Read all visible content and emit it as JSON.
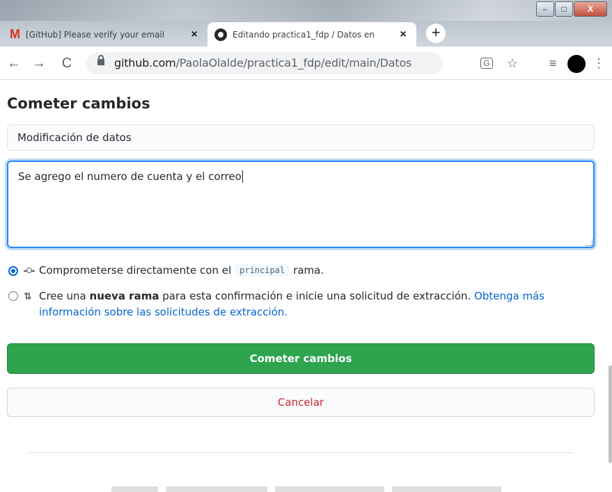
{
  "browser": {
    "tabs": [
      {
        "title": "[GitHub] Please verify your email",
        "icon": "gmail-icon",
        "active": false
      },
      {
        "title": "Editando practica1_fdp / Datos en",
        "icon": "github-icon",
        "active": true
      }
    ],
    "url_domain": "github.com",
    "url_path": "/PaolaOlalde/practica1_fdp/edit/main/Datos"
  },
  "commit": {
    "heading": "Cometer cambios",
    "summary_value": "Modificación de datos",
    "description_value": "Se agrego el numero de cuenta y el correo",
    "option_direct": {
      "prefix": "Comprometerse directamente con el",
      "branch": "principal",
      "suffix": "rama."
    },
    "option_new_branch": {
      "prefix": "Cree una",
      "bold": "nueva rama",
      "suffix": "para esta confirmación e inicie una solicitud de extracción.",
      "link": "Obtenga más información sobre las solicitudes de extracción."
    },
    "commit_button": "Cometer cambios",
    "cancel_button": "Cancelar"
  },
  "colors": {
    "accent": "#0366d6",
    "commit_green": "#2ea44f",
    "cancel_red": "#cb2431"
  }
}
